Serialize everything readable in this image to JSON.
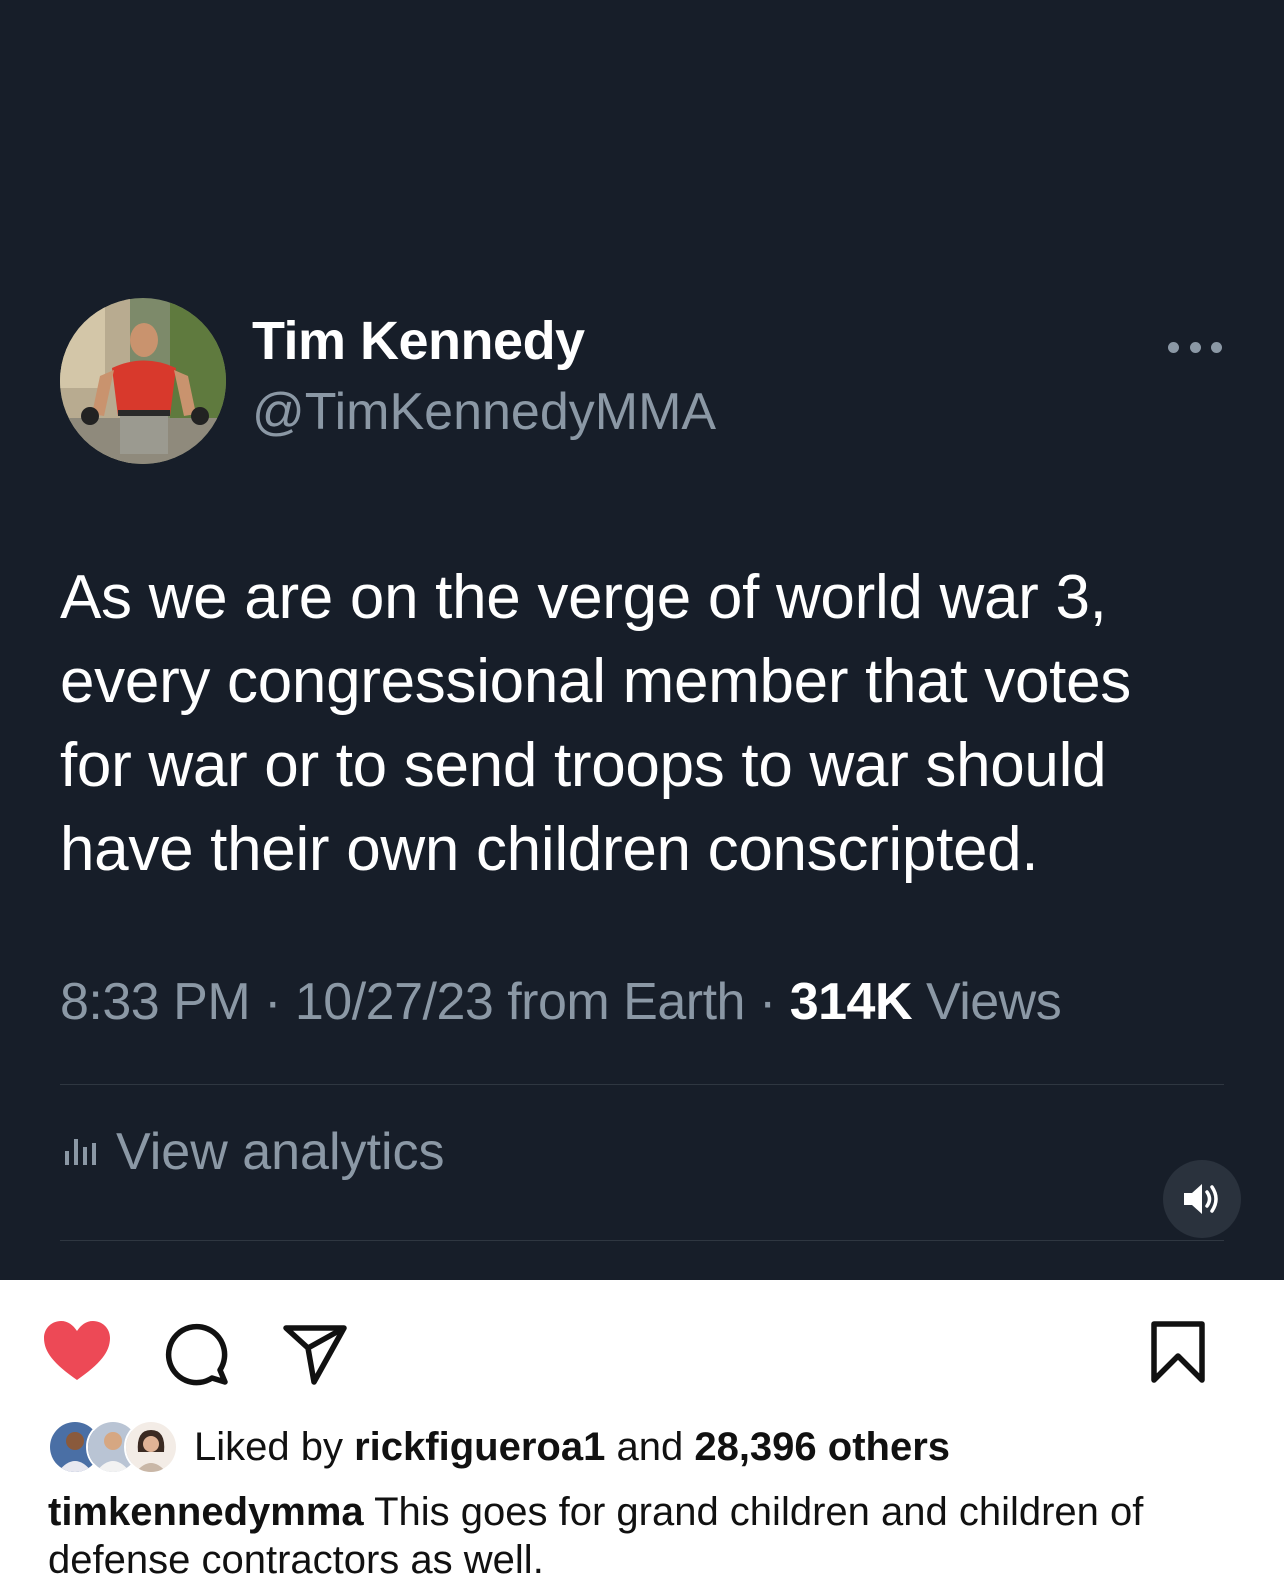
{
  "tweet": {
    "display_name": "Tim Kennedy",
    "handle": "@TimKennedyMMA",
    "text_lines": [
      "As we are on the verge of world war 3,",
      "every congressional member that votes",
      "for war or to send troops to war should",
      "have their own children conscripted."
    ],
    "time": "8:33 PM",
    "date": "10/27/23 from Earth",
    "views_count": "314K",
    "views_label": "Views",
    "analytics_label": "View analytics",
    "more_icon": "more-horizontal-icon",
    "sound_icon": "speaker-icon",
    "bg_color": "#171e29",
    "secondary_text_color": "#8b98a5"
  },
  "post": {
    "liked_prefix": "Liked by",
    "liked_user": "rickfigueroa1",
    "liked_and": "and",
    "liked_others": "28,396 others",
    "caption_user": "timkennedymma",
    "caption_text": "This goes for grand children and children of defense contractors as well.",
    "heart_color": "#ed4956",
    "icons": [
      "heart-icon",
      "comment-icon",
      "share-icon",
      "bookmark-icon"
    ]
  }
}
